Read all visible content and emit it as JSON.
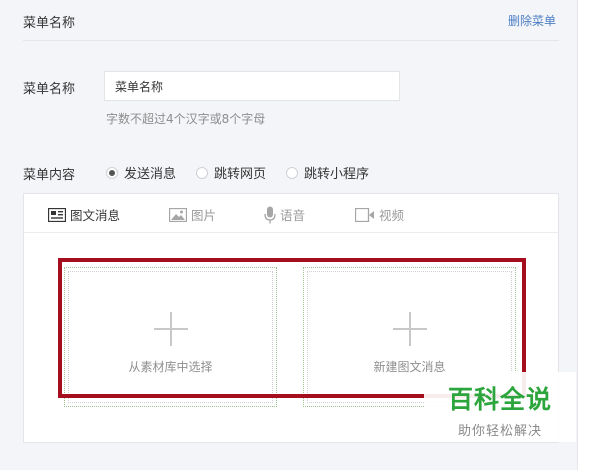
{
  "header": {
    "title": "菜单名称",
    "delete_label": "删除菜单"
  },
  "menu_name": {
    "label": "菜单名称",
    "value": "菜单名称",
    "hint": "字数不超过4个汉字或8个字母"
  },
  "menu_content": {
    "label": "菜单内容",
    "options": [
      {
        "label": "发送消息",
        "checked": true
      },
      {
        "label": "跳转网页",
        "checked": false
      },
      {
        "label": "跳转小程序",
        "checked": false
      }
    ]
  },
  "tabs": [
    {
      "label": "图文消息",
      "icon": "article-icon",
      "active": true
    },
    {
      "label": "图片",
      "icon": "image-icon",
      "active": false
    },
    {
      "label": "语音",
      "icon": "microphone-icon",
      "active": false
    },
    {
      "label": "视频",
      "icon": "video-icon",
      "active": false
    }
  ],
  "cards": [
    {
      "label": "从素材库中选择",
      "icon": "plus-icon"
    },
    {
      "label": "新建图文消息",
      "icon": "plus-icon"
    }
  ],
  "highlight_color": "#a50e1c",
  "watermark": {
    "logo_text": "百科全说",
    "slogan": "助你轻松解决"
  }
}
